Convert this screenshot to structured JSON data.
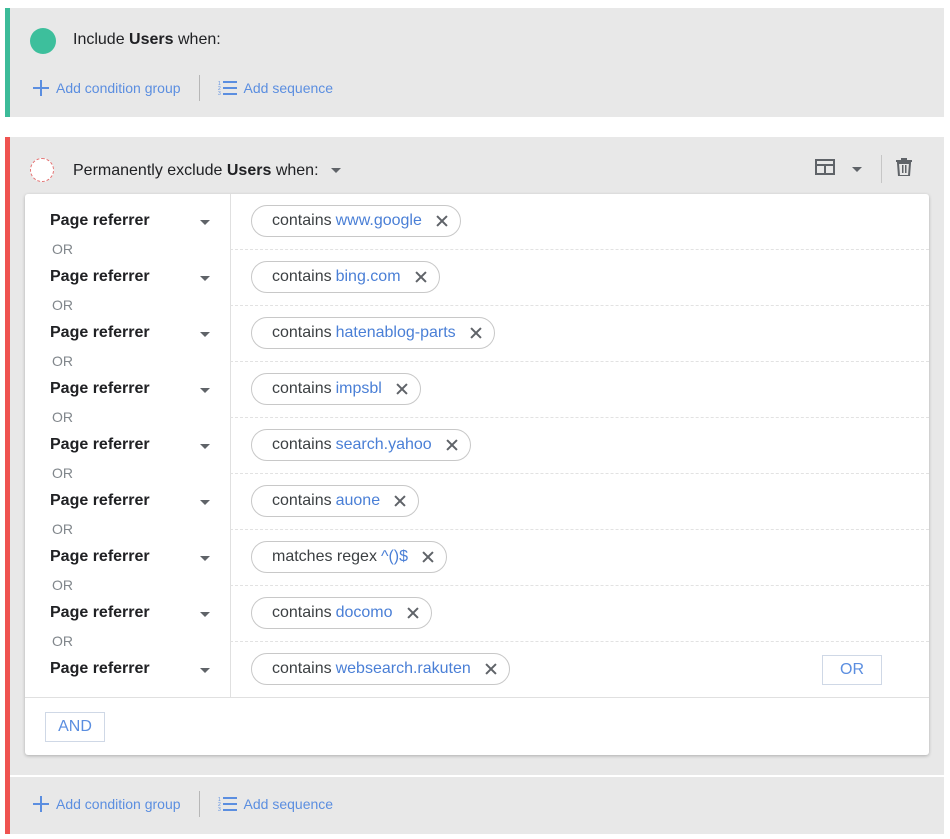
{
  "include_group": {
    "prefix": "Include",
    "entity": "Users",
    "suffix": "when:",
    "add_condition_group": "Add condition group",
    "add_sequence": "Add sequence"
  },
  "exclude_group": {
    "prefix": "Permanently exclude",
    "entity": "Users",
    "suffix": "when:",
    "add_condition_group": "Add condition group",
    "add_sequence": "Add sequence",
    "conditions": [
      {
        "dimension": "Page referrer",
        "operator": "contains",
        "value": "www.google"
      },
      {
        "dimension": "Page referrer",
        "operator": "contains",
        "value": "bing.com"
      },
      {
        "dimension": "Page referrer",
        "operator": "contains",
        "value": "hatenablog-parts"
      },
      {
        "dimension": "Page referrer",
        "operator": "contains",
        "value": "impsbl"
      },
      {
        "dimension": "Page referrer",
        "operator": "contains",
        "value": "search.yahoo"
      },
      {
        "dimension": "Page referrer",
        "operator": "contains",
        "value": "auone"
      },
      {
        "dimension": "Page referrer",
        "operator": "matches regex",
        "value": "^()$"
      },
      {
        "dimension": "Page referrer",
        "operator": "contains",
        "value": "docomo"
      },
      {
        "dimension": "Page referrer",
        "operator": "contains",
        "value": "websearch.rakuten"
      }
    ],
    "or_separator": "OR",
    "or_button": "OR",
    "and_button": "AND"
  },
  "colors": {
    "include_accent": "#3cbb99",
    "exclude_accent": "#ef5350",
    "link_blue": "#5b8ee0",
    "value_blue": "#4a7fd6"
  }
}
